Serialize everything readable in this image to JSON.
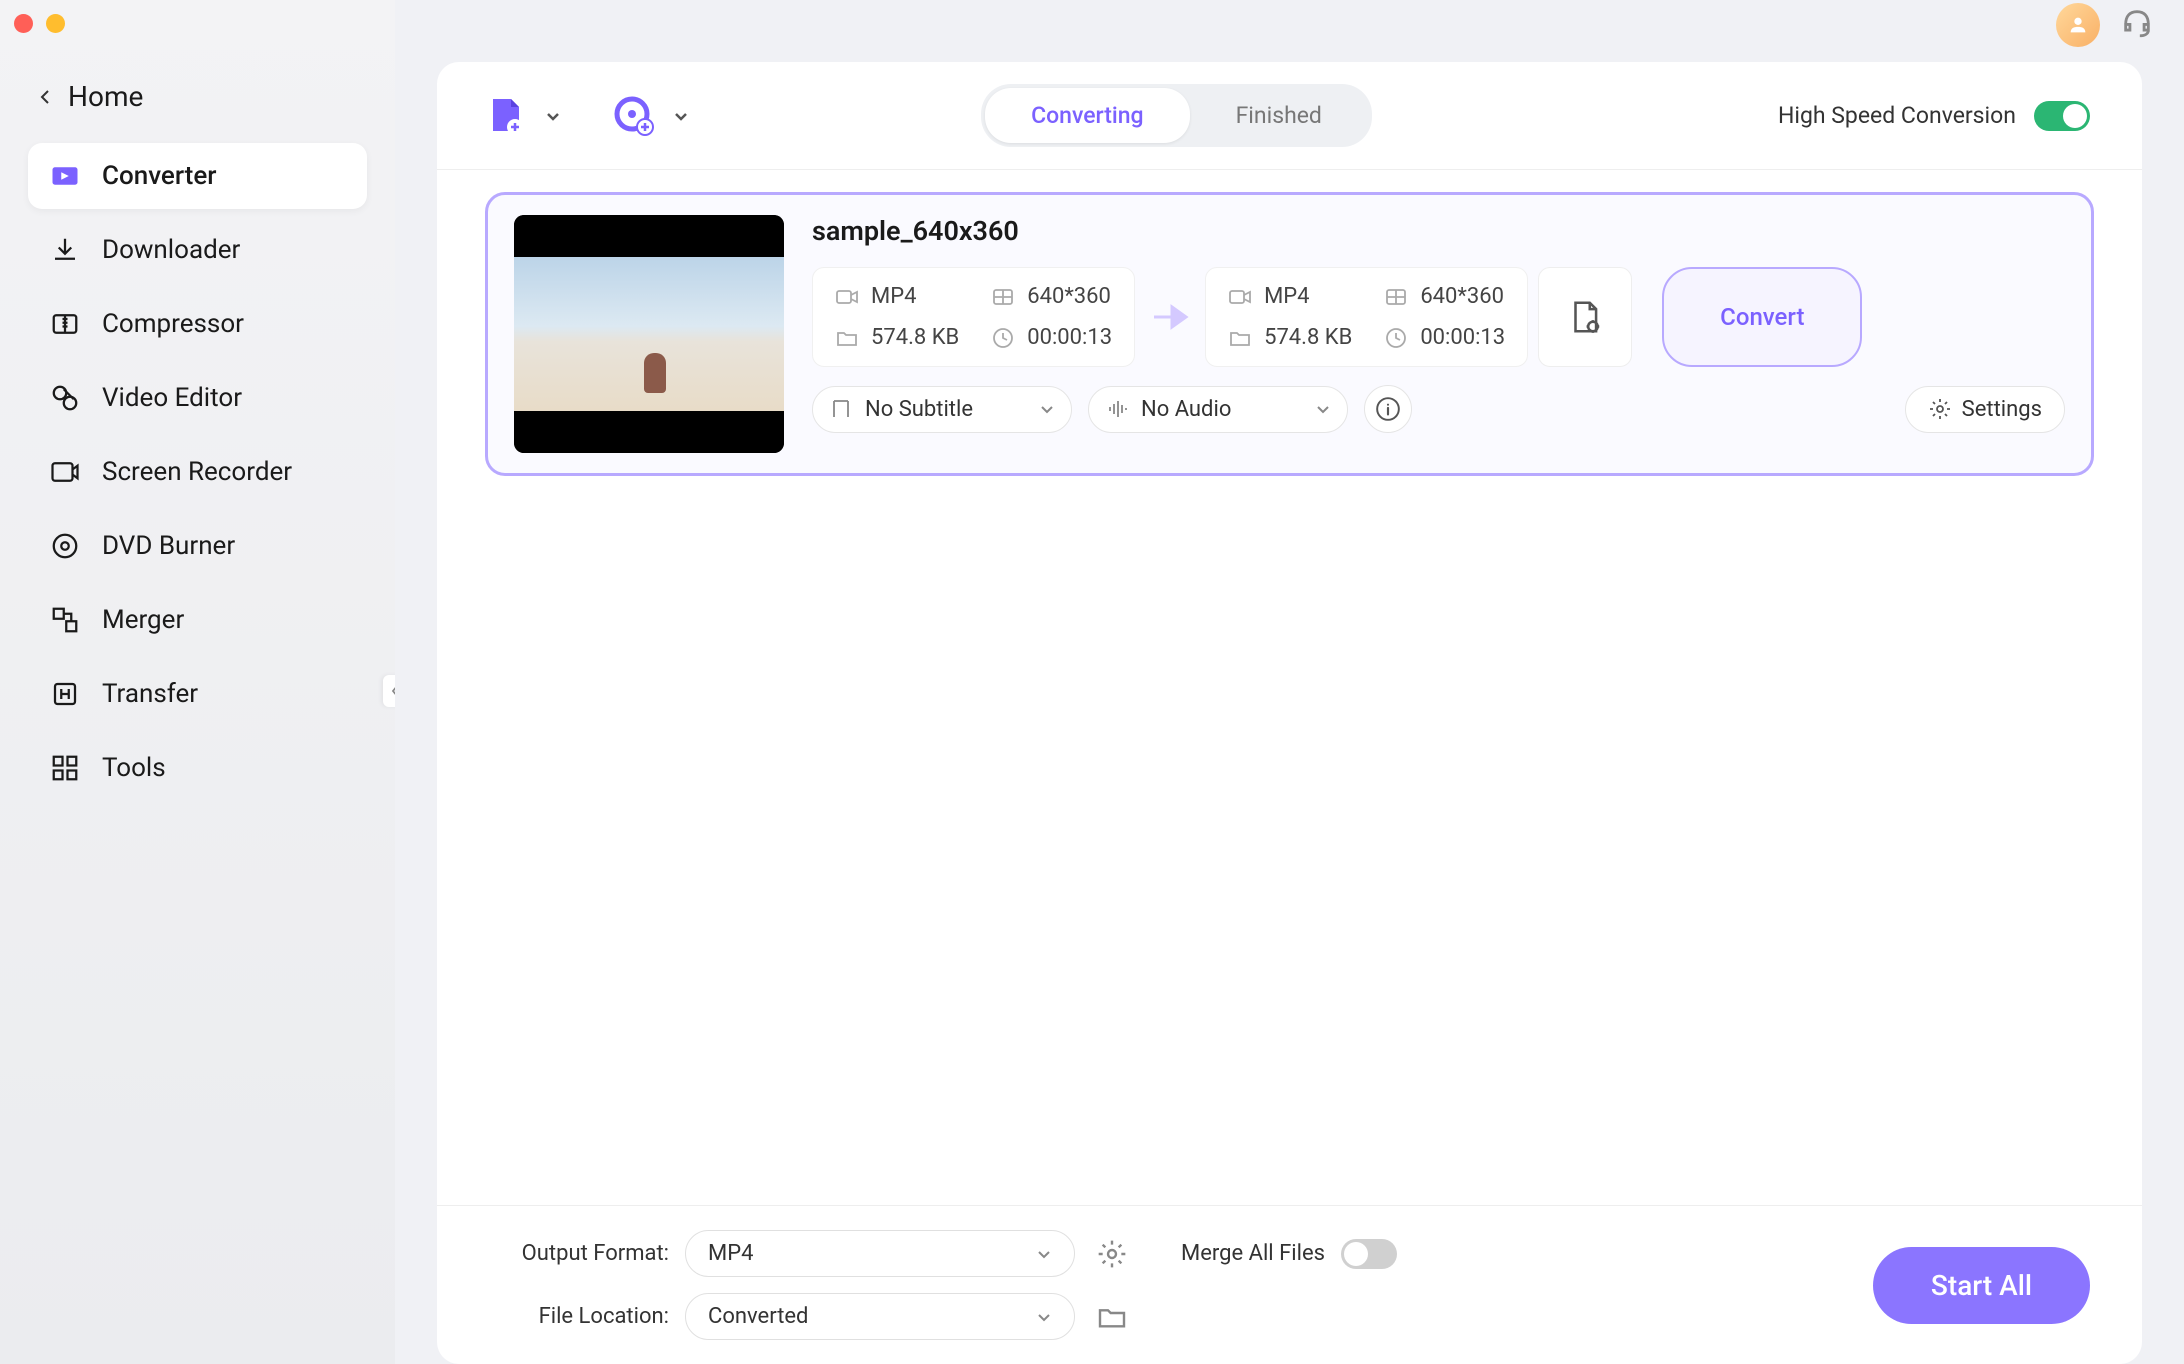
{
  "home_label": "Home",
  "sidebar": {
    "items": [
      {
        "label": "Converter",
        "icon": "converter-icon",
        "active": true
      },
      {
        "label": "Downloader",
        "icon": "downloader-icon",
        "active": false
      },
      {
        "label": "Compressor",
        "icon": "compressor-icon",
        "active": false
      },
      {
        "label": "Video Editor",
        "icon": "editor-icon",
        "active": false
      },
      {
        "label": "Screen Recorder",
        "icon": "recorder-icon",
        "active": false
      },
      {
        "label": "DVD Burner",
        "icon": "dvd-icon",
        "active": false
      },
      {
        "label": "Merger",
        "icon": "merger-icon",
        "active": false
      },
      {
        "label": "Transfer",
        "icon": "transfer-icon",
        "active": false
      },
      {
        "label": "Tools",
        "icon": "tools-icon",
        "active": false
      }
    ]
  },
  "tabs": {
    "converting": "Converting",
    "finished": "Finished",
    "active": "converting"
  },
  "high_speed_label": "High Speed Conversion",
  "high_speed_on": true,
  "file": {
    "name": "sample_640x360",
    "source": {
      "format": "MP4",
      "resolution": "640*360",
      "size": "574.8 KB",
      "duration": "00:00:13"
    },
    "target": {
      "format": "MP4",
      "resolution": "640*360",
      "size": "574.8 KB",
      "duration": "00:00:13"
    },
    "subtitle": "No Subtitle",
    "audio": "No Audio",
    "settings_label": "Settings",
    "convert_label": "Convert"
  },
  "output": {
    "format_label": "Output Format:",
    "format_value": "MP4",
    "location_label": "File Location:",
    "location_value": "Converted"
  },
  "merge_label": "Merge All Files",
  "merge_on": false,
  "start_all_label": "Start All"
}
